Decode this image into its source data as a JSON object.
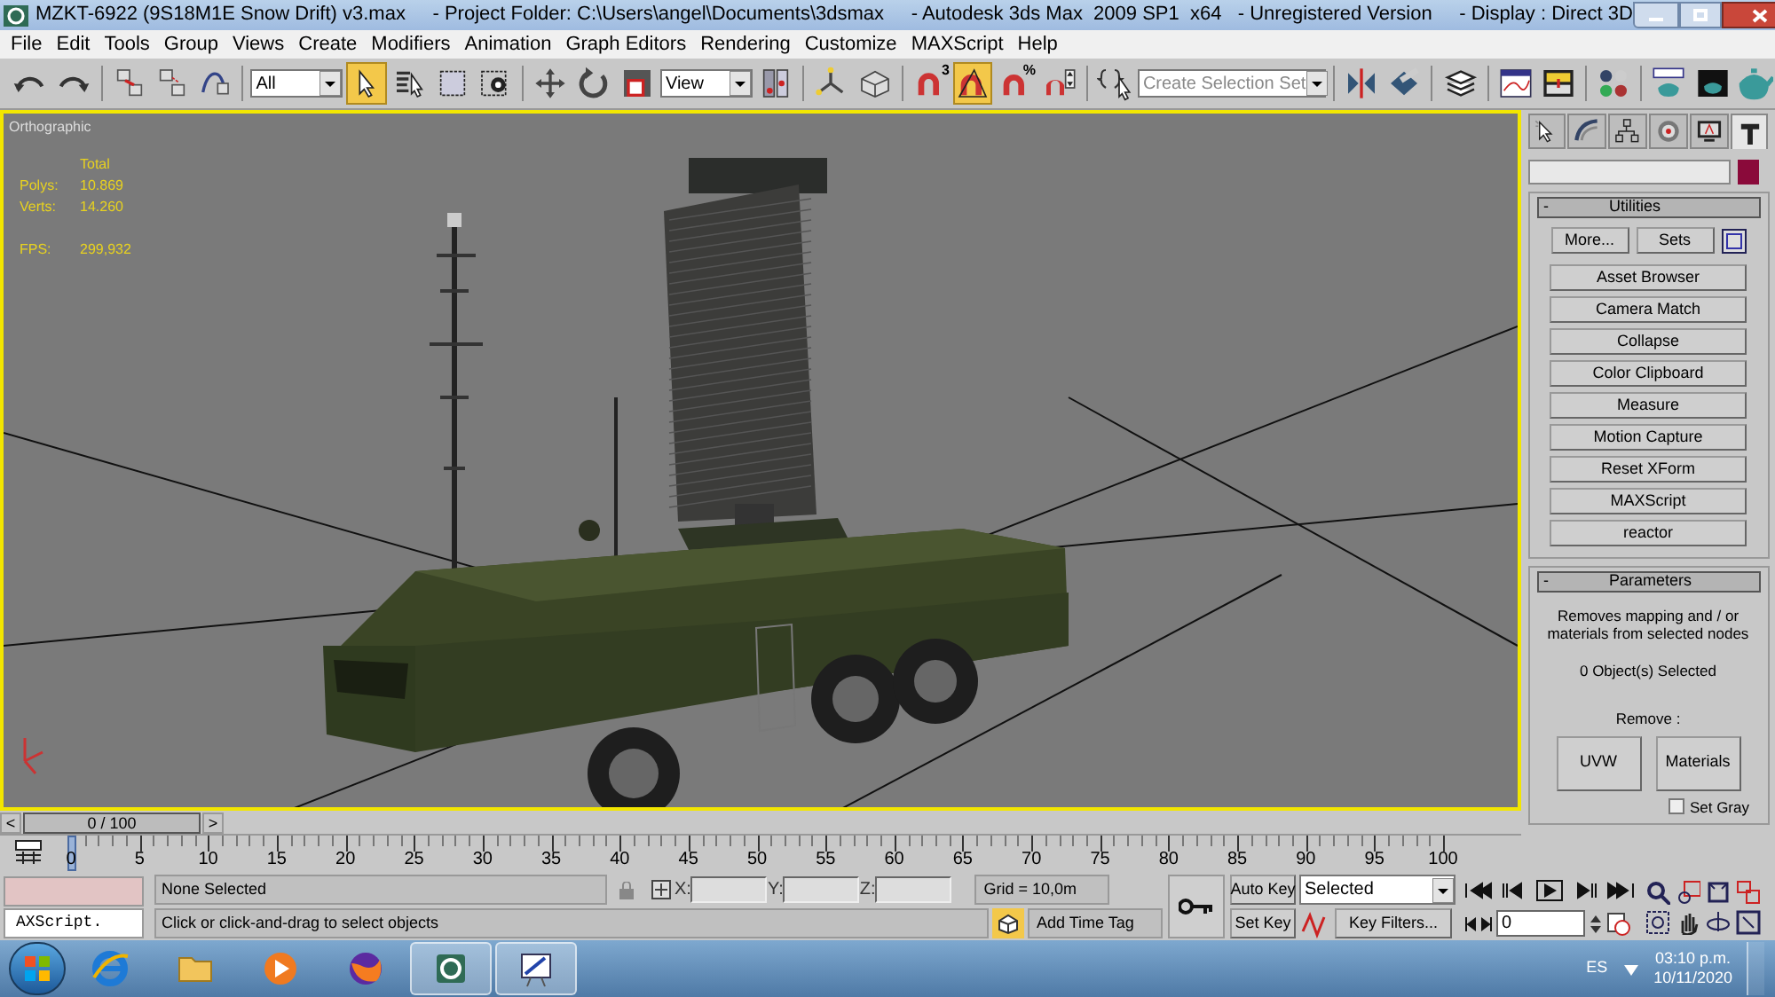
{
  "window": {
    "title": "MZKT-6922 (9S18M1E Snow Drift) v3.max     - Project Folder: C:\\Users\\angel\\Documents\\3dsmax     - Autodesk 3ds Max  2009 SP1  x64   - Unregistered Version     - Display : Direct 3D"
  },
  "menu": [
    "File",
    "Edit",
    "Tools",
    "Group",
    "Views",
    "Create",
    "Modifiers",
    "Animation",
    "Graph Editors",
    "Rendering",
    "Customize",
    "MAXScript",
    "Help"
  ],
  "toolbar": {
    "selection_filter": "All",
    "reference_coord": "View",
    "named_selection": {
      "placeholder": "Create Selection Set"
    },
    "tools": [
      {
        "kind": "undo",
        "selected": false
      },
      {
        "kind": "redo",
        "selected": false
      },
      {
        "kind": "sep"
      },
      {
        "kind": "link",
        "selected": false
      },
      {
        "kind": "unlink",
        "selected": false
      },
      {
        "kind": "bind",
        "selected": false
      },
      {
        "kind": "sep"
      },
      {
        "kind": "filter"
      },
      {
        "kind": "select",
        "selected": true
      },
      {
        "kind": "select-by-name",
        "selected": false
      },
      {
        "kind": "region",
        "selected": false
      },
      {
        "kind": "crossing",
        "selected": false
      },
      {
        "kind": "sep"
      },
      {
        "kind": "move",
        "selected": false
      },
      {
        "kind": "rotate",
        "selected": false
      },
      {
        "kind": "scale",
        "selected": false
      },
      {
        "kind": "coord"
      },
      {
        "kind": "pivot",
        "selected": false
      },
      {
        "kind": "sep"
      },
      {
        "kind": "manipulate",
        "selected": false
      },
      {
        "kind": "keyboard",
        "selected": false
      },
      {
        "kind": "sep"
      },
      {
        "kind": "snap",
        "selected": false,
        "badge": "3"
      },
      {
        "kind": "angle-snap",
        "selected": true
      },
      {
        "kind": "percent-snap",
        "selected": false,
        "badge": "%"
      },
      {
        "kind": "spinner-snap",
        "selected": false
      },
      {
        "kind": "sep"
      },
      {
        "kind": "edit-sets",
        "selected": false
      },
      {
        "kind": "named"
      },
      {
        "kind": "sep"
      },
      {
        "kind": "mirror",
        "selected": false
      },
      {
        "kind": "align",
        "selected": false
      },
      {
        "kind": "sep"
      },
      {
        "kind": "layers",
        "selected": false
      },
      {
        "kind": "sep"
      },
      {
        "kind": "curve-editor",
        "selected": false
      },
      {
        "kind": "schematic",
        "selected": false
      },
      {
        "kind": "sep"
      },
      {
        "kind": "material",
        "selected": false
      },
      {
        "kind": "sep"
      },
      {
        "kind": "render-setup",
        "selected": false
      },
      {
        "kind": "render-frame",
        "selected": false
      },
      {
        "kind": "render",
        "selected": false
      }
    ]
  },
  "viewport": {
    "label": "Orthographic",
    "stats_header": "Total",
    "stats": [
      {
        "label": "Polys:",
        "value": "10.869"
      },
      {
        "label": "Verts:",
        "value": "14.260"
      }
    ],
    "fps": {
      "label": "FPS:",
      "value": "299,932"
    }
  },
  "command_panel": {
    "tabs": [
      {
        "kind": "create",
        "selected": false
      },
      {
        "kind": "modify",
        "selected": false
      },
      {
        "kind": "hierarchy",
        "selected": false
      },
      {
        "kind": "motion",
        "selected": false
      },
      {
        "kind": "display",
        "selected": false
      },
      {
        "kind": "utilities",
        "selected": true
      }
    ],
    "utilities": {
      "toggle": "-",
      "title": "Utilities",
      "more": "More...",
      "sets": "Sets",
      "items": [
        "Asset Browser",
        "Camera Match",
        "Collapse",
        "Color Clipboard",
        "Measure",
        "Motion Capture",
        "Reset XForm",
        "MAXScript",
        "reactor"
      ]
    },
    "parameters": {
      "toggle": "-",
      "title": "Parameters",
      "description": "Removes mapping and / or materials from selected nodes",
      "count": "0 Object(s) Selected",
      "remove_label": "Remove :",
      "buttons": [
        "UVW",
        "Materials"
      ],
      "set_gray": {
        "label": "Set Gray",
        "checked": false
      }
    }
  },
  "time_slider": {
    "prev": "<",
    "position": "0 / 100",
    "next": ">",
    "level": 0
  },
  "track": {
    "ticks": [
      "0",
      "5",
      "10",
      "15",
      "20",
      "25",
      "30",
      "35",
      "40",
      "45",
      "50",
      "55",
      "60",
      "65",
      "70",
      "75",
      "80",
      "85",
      "90",
      "95",
      "100"
    ]
  },
  "status": {
    "maxscript": "AXScript.",
    "selection": "None Selected",
    "prompt": "Click or click-and-drag to select objects",
    "x_label": "X:",
    "y_label": "Y:",
    "z_label": "Z:",
    "grid": "Grid = 10,0m",
    "time_tag": "Add Time Tag",
    "auto_key": "Auto Key",
    "set_key": "Set Key",
    "key_mode": "Selected",
    "key_filters": "Key Filters...",
    "frame": "0"
  },
  "taskbar": {
    "apps": [
      {
        "kind": "browser",
        "selected": false
      },
      {
        "kind": "folder",
        "selected": false
      },
      {
        "kind": "media",
        "selected": false
      },
      {
        "kind": "fox",
        "selected": false
      },
      {
        "kind": "max",
        "selected": true
      },
      {
        "kind": "paint",
        "selected": true
      }
    ],
    "language": "ES",
    "time": "03:10 p.m.",
    "date": "10/11/2020"
  }
}
